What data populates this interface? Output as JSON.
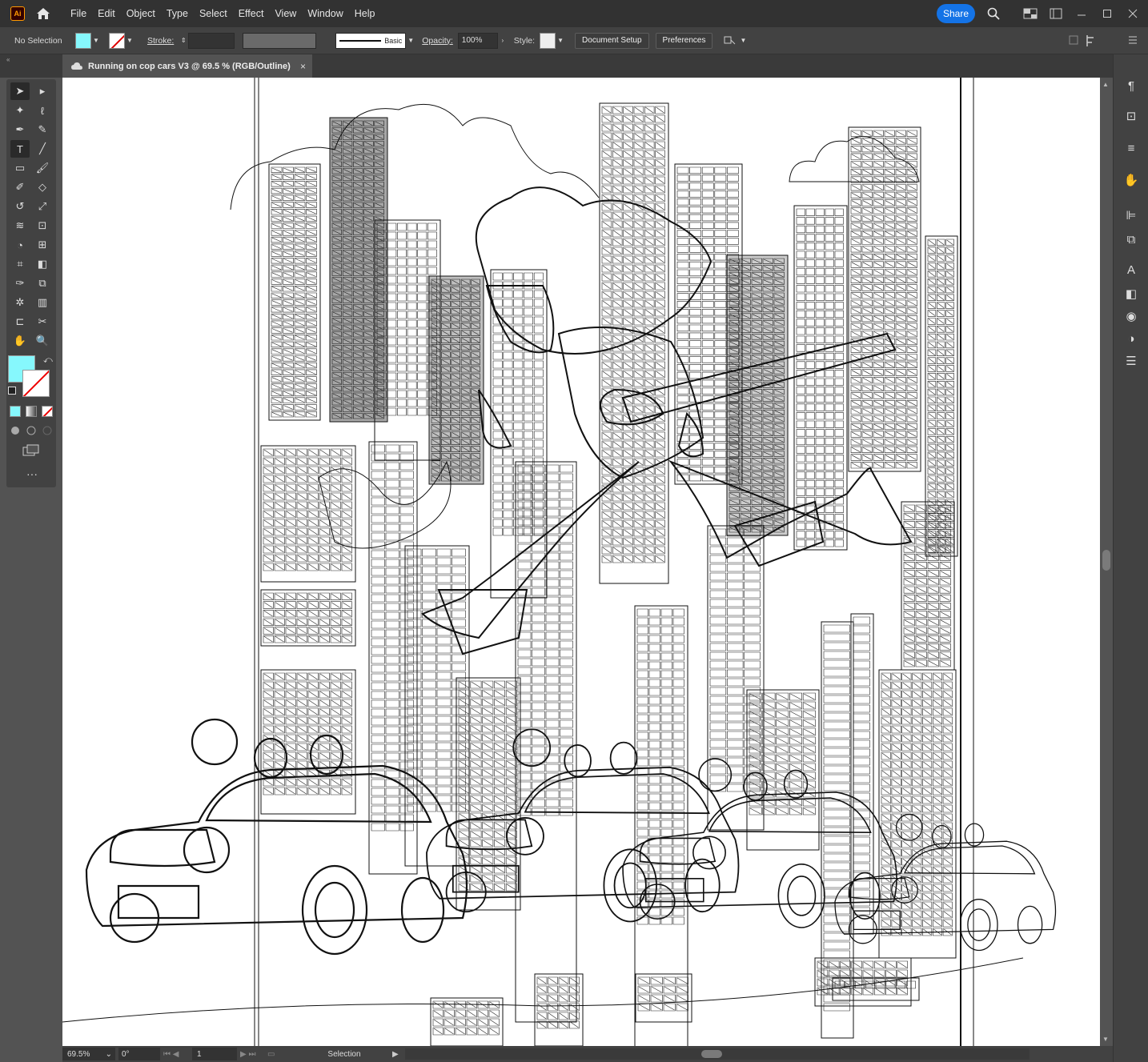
{
  "app": {
    "logo": "Ai",
    "menu": [
      "File",
      "Edit",
      "Object",
      "Type",
      "Select",
      "Effect",
      "View",
      "Window",
      "Help"
    ],
    "share_label": "Share"
  },
  "control": {
    "selection_label": "No Selection",
    "stroke_label": "Stroke:",
    "brush_label": "Basic",
    "opacity_label": "Opacity:",
    "opacity_value": "100%",
    "style_label": "Style:",
    "document_setup": "Document Setup",
    "preferences": "Preferences"
  },
  "document": {
    "tab_title": "Running on cop cars V3 @ 69.5 % (RGB/Outline)",
    "close_symbol": "×"
  },
  "status": {
    "zoom": "69.5%",
    "rotation": "0°",
    "artboard": "1",
    "tool": "Selection"
  },
  "colors": {
    "fill": "#86f8fd",
    "accent": "#1473e6",
    "chrome_dark": "#323232",
    "chrome_mid": "#424242",
    "chrome_light": "#535353"
  },
  "tools": [
    "selection-tool-icon",
    "direct-selection-tool-icon",
    "magic-wand-icon",
    "lasso-icon",
    "pen-tool-icon",
    "curvature-icon",
    "type-tool-icon",
    "line-tool-icon",
    "rectangle-tool-icon",
    "paintbrush-icon",
    "shaper-icon",
    "eraser-icon",
    "rotate-icon",
    "scale-icon",
    "width-icon",
    "free-transform-icon",
    "shape-builder-icon",
    "perspective-grid-icon",
    "mesh-icon",
    "gradient-icon",
    "eyedropper-icon",
    "blend-icon",
    "symbol-sprayer-icon",
    "column-graph-icon",
    "artboard-icon",
    "slice-icon",
    "hand-icon",
    "zoom-icon"
  ],
  "right_panel": [
    "paragraph-icon",
    "transform-icon",
    "properties-icon",
    "libraries-icon",
    "align-icon",
    "pathfinder-icon",
    "character-icon",
    "gradient-panel-icon",
    "appearance-icon",
    "color-theme-icon",
    "layers-icon"
  ]
}
